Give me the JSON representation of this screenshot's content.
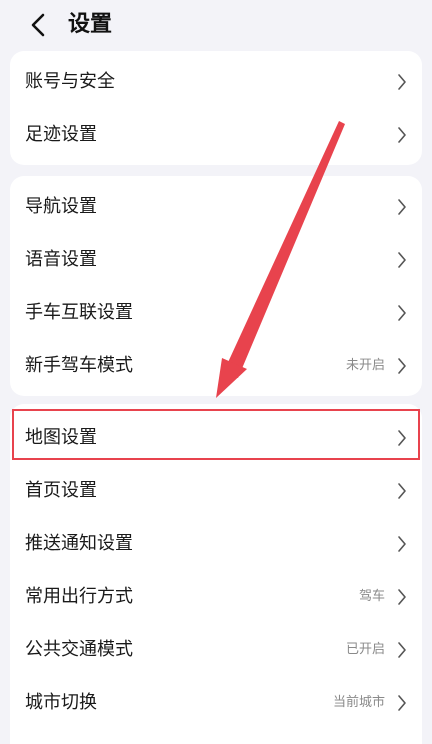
{
  "header": {
    "title": "设置"
  },
  "groups": [
    {
      "items": [
        {
          "label": "账号与安全",
          "value": ""
        },
        {
          "label": "足迹设置",
          "value": ""
        }
      ]
    },
    {
      "items": [
        {
          "label": "导航设置",
          "value": ""
        },
        {
          "label": "语音设置",
          "value": ""
        },
        {
          "label": "手车互联设置",
          "value": ""
        },
        {
          "label": "新手驾车模式",
          "value": "未开启"
        }
      ]
    },
    {
      "items": [
        {
          "label": "地图设置",
          "value": ""
        },
        {
          "label": "首页设置",
          "value": ""
        },
        {
          "label": "推送通知设置",
          "value": ""
        },
        {
          "label": "常用出行方式",
          "value": "驾车"
        },
        {
          "label": "公共交通模式",
          "value": "已开启"
        },
        {
          "label": "城市切换",
          "value": "当前城市"
        }
      ]
    }
  ],
  "colors": {
    "background": "#f3f3f8",
    "card": "#ffffff",
    "annotation": "#e8434d"
  },
  "icons": {
    "back": "chevron-left-icon",
    "row_arrow": "chevron-right-icon"
  }
}
